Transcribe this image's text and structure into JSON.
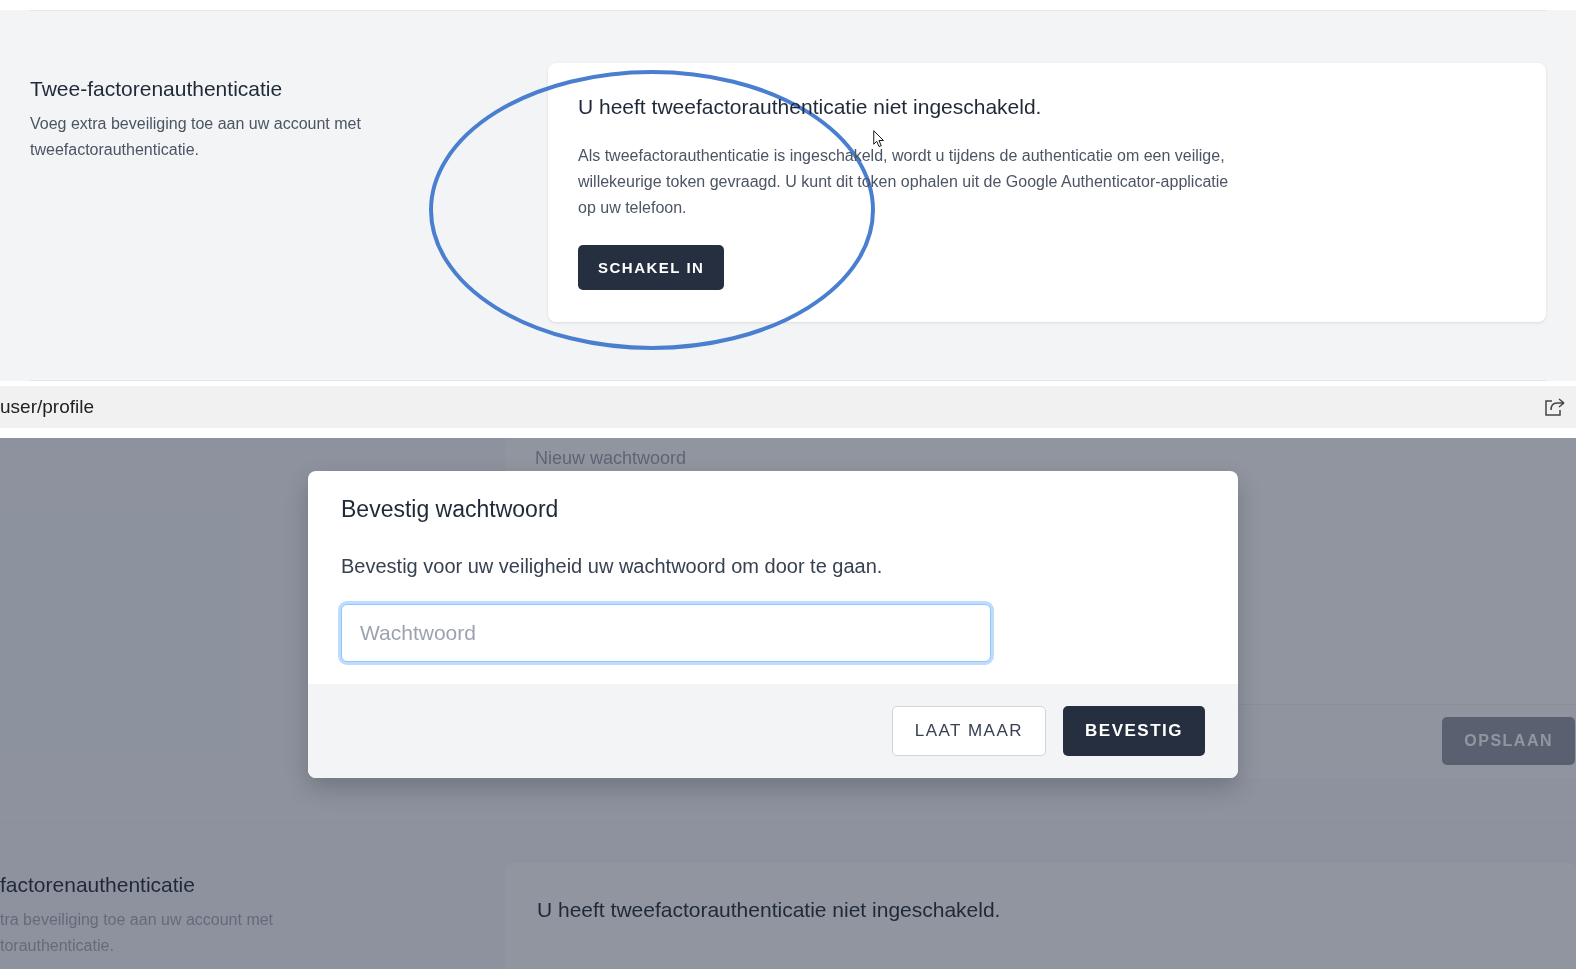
{
  "top_section": {
    "title": "Twee-factorenauthenticatie",
    "description": "Voeg extra beveiliging toe aan uw account met tweefactorauthenticatie.",
    "card": {
      "heading": "U heeft tweefactorauthenticatie niet ingeschakeld.",
      "body": "Als tweefactorauthenticatie is ingeschakeld, wordt u tijdens de authenticatie om een veilige, willekeurige token gevraagd. U kunt dit token ophalen uit de Google Authenticator-applicatie op uw telefoon.",
      "button": "SCHAKEL IN"
    }
  },
  "address_bar": {
    "url": "user/profile"
  },
  "background_page": {
    "field_label": "Nieuw wachtwoord",
    "save_button": "OPSLAAN",
    "section_title": "factorenauthenticatie",
    "section_description": "tra beveiliging toe aan uw account met torauthenticatie.",
    "card_heading": "U heeft tweefactorauthenticatie niet ingeschakeld."
  },
  "modal": {
    "title": "Bevestig wachtwoord",
    "message": "Bevestig voor uw veiligheid uw wachtwoord om door te gaan.",
    "password_field": {
      "placeholder": "Wachtwoord"
    },
    "buttons": [
      {
        "label": "LAAT MAAR",
        "kind": "secondary"
      },
      {
        "label": "BEVESTIG",
        "kind": "primary"
      }
    ]
  }
}
